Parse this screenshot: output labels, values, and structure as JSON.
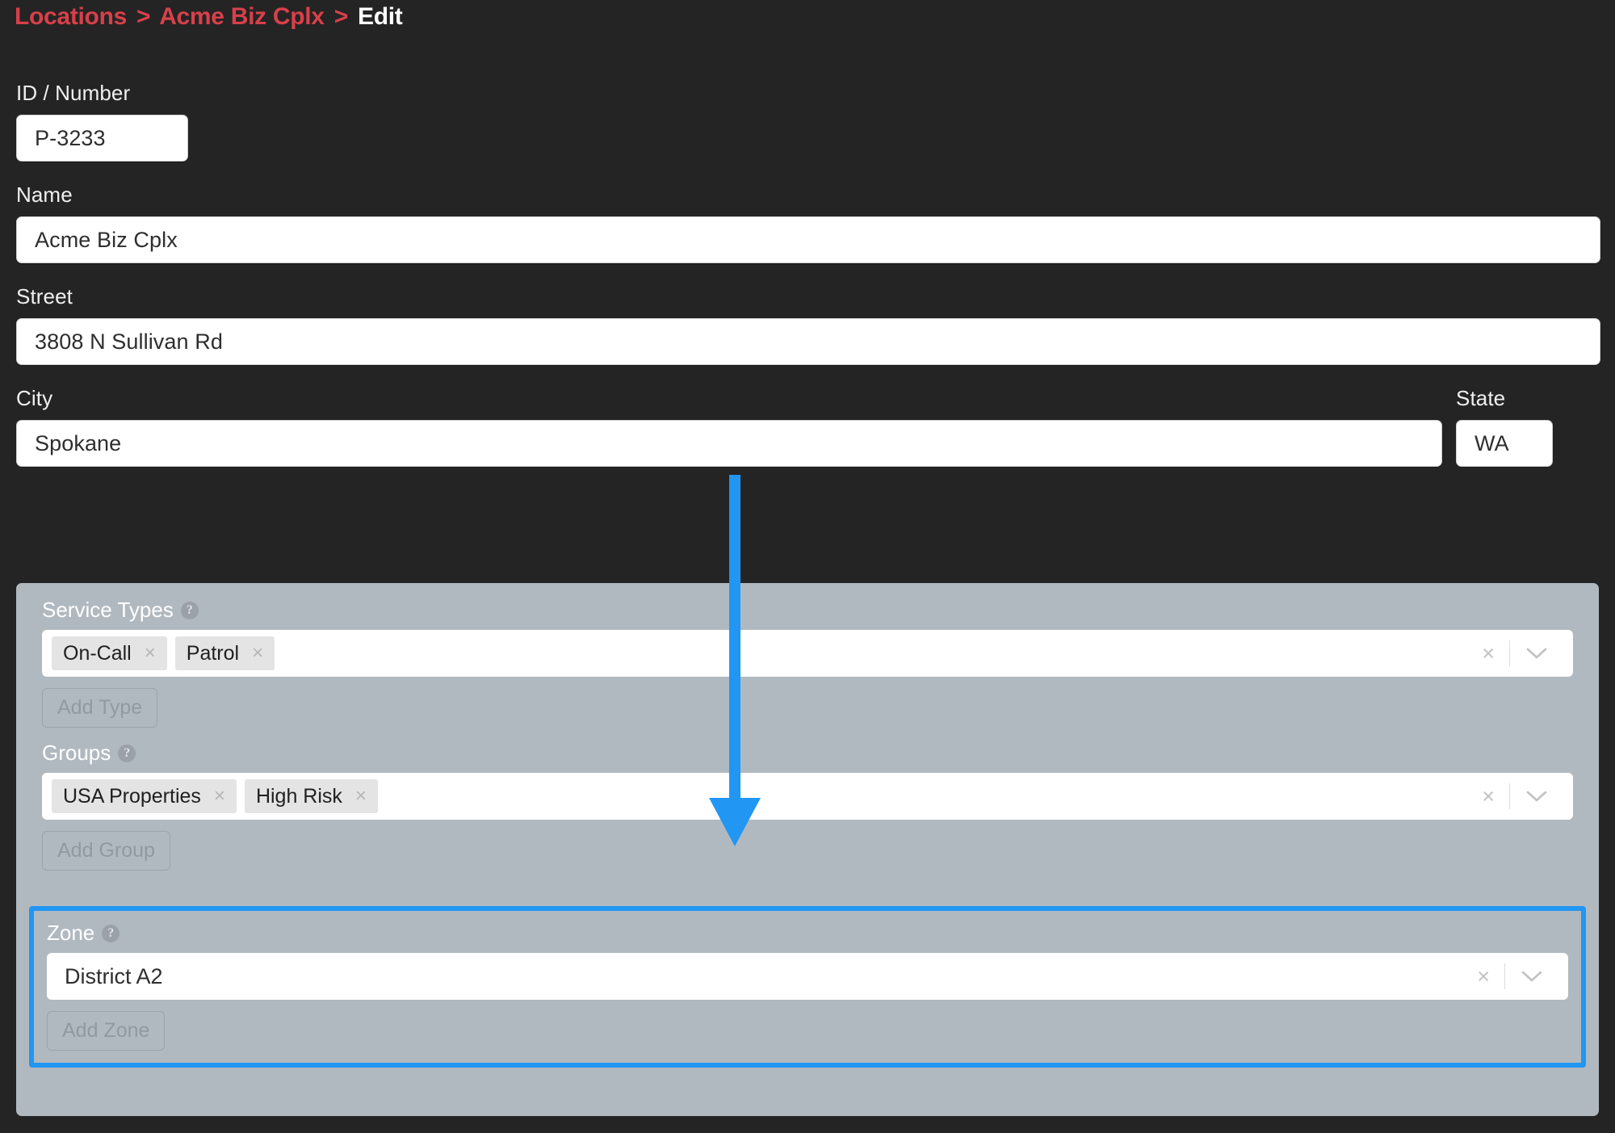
{
  "breadcrumb": {
    "root_label": "Locations",
    "separator": ">",
    "parent_label": "Acme Biz Cplx",
    "current_label": "Edit"
  },
  "form": {
    "id_number": {
      "label": "ID / Number",
      "value": "P-3233"
    },
    "name": {
      "label": "Name",
      "value": "Acme Biz Cplx"
    },
    "street": {
      "label": "Street",
      "value": "3808 N Sullivan Rd"
    },
    "city": {
      "label": "City",
      "value": "Spokane"
    },
    "state": {
      "label": "State",
      "value": "WA"
    }
  },
  "panel": {
    "service_types": {
      "label": "Service Types",
      "help_glyph": "?",
      "tags": [
        {
          "label": "On-Call",
          "remove_glyph": "×"
        },
        {
          "label": "Patrol",
          "remove_glyph": "×"
        }
      ],
      "clear_glyph": "×",
      "add_button_label": "Add Type"
    },
    "groups": {
      "label": "Groups",
      "help_glyph": "?",
      "tags": [
        {
          "label": "USA Properties",
          "remove_glyph": "×"
        },
        {
          "label": "High Risk",
          "remove_glyph": "×"
        }
      ],
      "clear_glyph": "×",
      "add_button_label": "Add Group"
    },
    "zone": {
      "label": "Zone",
      "help_glyph": "?",
      "value": "District A2",
      "clear_glyph": "×",
      "add_button_label": "Add Zone"
    }
  },
  "colors": {
    "background": "#242424",
    "breadcrumb_link": "#d8404a",
    "panel": "#b1b9c0",
    "highlight": "#2196f3"
  }
}
